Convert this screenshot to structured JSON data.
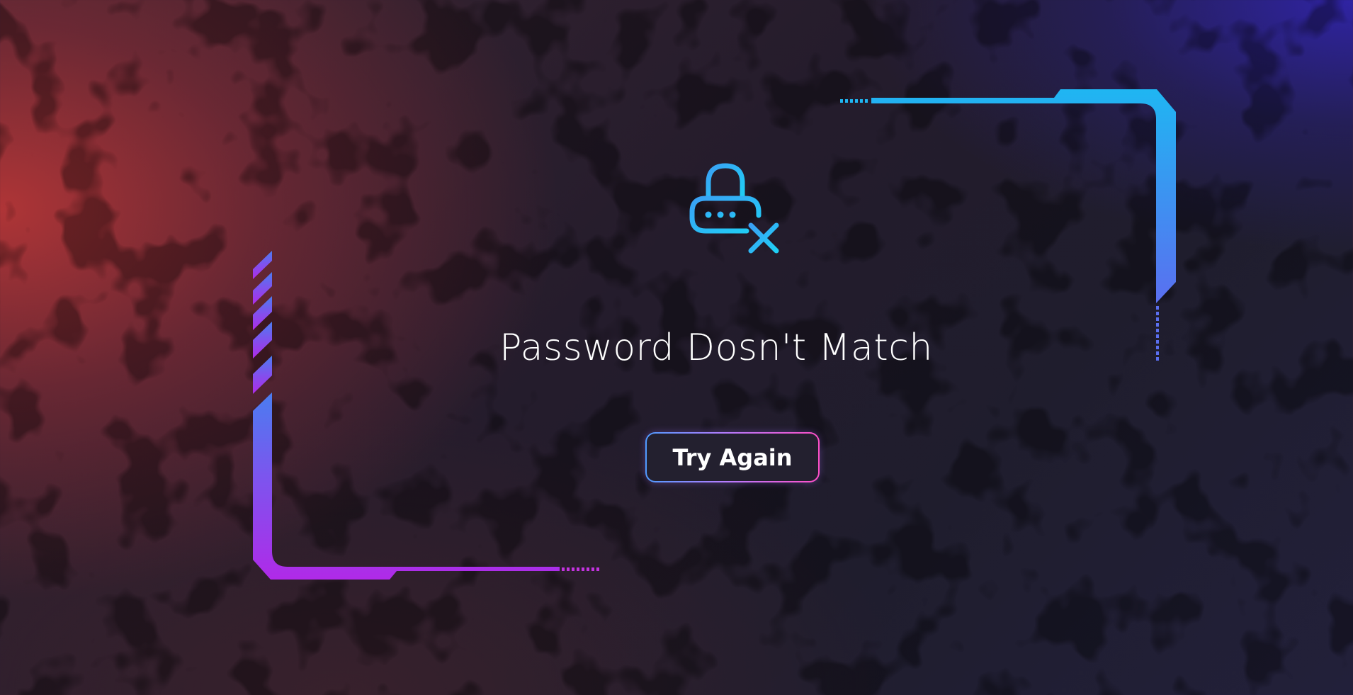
{
  "dialog": {
    "title": "Password Dosn't Match",
    "try_again_label": "Try Again",
    "icon": "lock-x-icon"
  },
  "colors": {
    "frame_cyan": "#1fb6f2",
    "frame_purple": "#b02ae8",
    "icon_blue": "#3ab0f0",
    "button_border_start": "#4f9bff",
    "button_border_end": "#ff4fc8"
  }
}
